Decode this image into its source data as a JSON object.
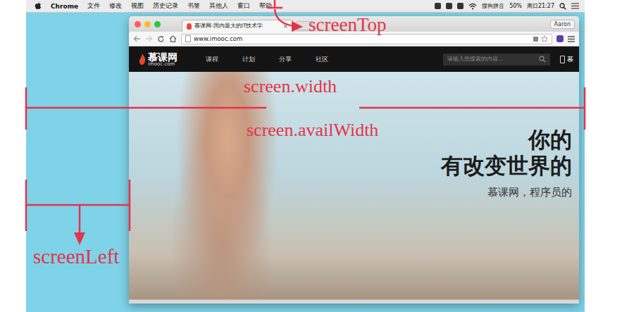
{
  "menu_bar": {
    "items": [
      "Chrome",
      "文件",
      "修改",
      "视图",
      "历史记录",
      "书签",
      "其他人",
      "窗口",
      "帮助"
    ],
    "status": [
      "搜狗拼音",
      "50%",
      "周日21:27"
    ]
  },
  "browser": {
    "tab": "慕课网-国内最大的IT技术学",
    "tab_close": "×",
    "profile": "Aaron",
    "url": "www.imooc.com"
  },
  "site": {
    "logo": "慕课网",
    "logo_sub": "imooc.com",
    "nav": [
      "课程",
      "计划",
      "分享",
      "社区"
    ],
    "search_placeholder": "请输入想搜索的内容...",
    "app_link": "慕",
    "hero": [
      "你的",
      "有改变世界的",
      "慕课网，程序员的"
    ]
  },
  "annotations": [
    {
      "label": "screenTop"
    },
    {
      "label": "screen.width"
    },
    {
      "label": "screen.availWidth"
    },
    {
      "label": "screenLeft"
    }
  ]
}
